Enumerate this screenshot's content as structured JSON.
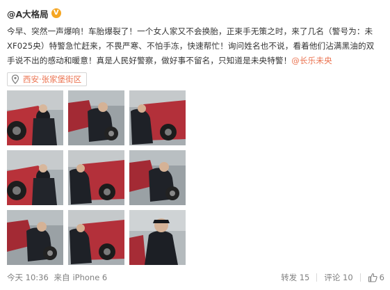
{
  "post": {
    "author": "@A大格局",
    "verified_badge": "V",
    "content_text": "今早、突然一声爆响！车胎爆裂了！一个女人家又不会换胎，正束手无策之时，来了几名（警号为：未XF025央）特警急忙赶来，不畏严寒、不怕手冻，快速帮忙！询问姓名也不说，看着他们沾满黑油的双手说不出的感动和暖意！真是人民好警察，做好事不留名，只知道是未央特警！",
    "mention": "@长乐未央",
    "location": "西安·张家堡街区",
    "photos": [
      {
        "label": "photo-1",
        "theme": "tire-left"
      },
      {
        "label": "photo-2",
        "theme": "crouch"
      },
      {
        "label": "photo-3",
        "theme": "car-right"
      },
      {
        "label": "photo-4",
        "theme": "tire-left"
      },
      {
        "label": "photo-5",
        "theme": "car-right"
      },
      {
        "label": "photo-6",
        "theme": "crouch"
      },
      {
        "label": "photo-7",
        "theme": "crouch"
      },
      {
        "label": "photo-8",
        "theme": "car-right"
      },
      {
        "label": "photo-9",
        "theme": "portrait"
      }
    ],
    "footer": {
      "time": "今天 10:36",
      "source_prefix": "来自",
      "source": "iPhone 6",
      "repost": "转发 15",
      "comment": "评论 10",
      "like_count": "6"
    }
  },
  "colors": {
    "accent": "#eb7350",
    "badge": "#f5a623",
    "muted": "#808080"
  }
}
